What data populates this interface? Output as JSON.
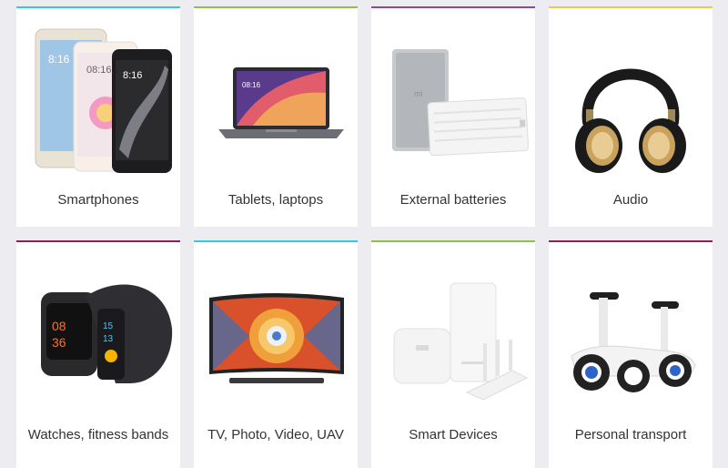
{
  "categories": [
    {
      "label": "Smartphones",
      "accent": "#33c7e8",
      "icon": "smartphones-icon"
    },
    {
      "label": "Tablets, laptops",
      "accent": "#8bc34a",
      "icon": "laptop-icon"
    },
    {
      "label": "External batteries",
      "accent": "#8e44ad",
      "icon": "power-bank-icon"
    },
    {
      "label": "Audio",
      "accent": "#f5c44b",
      "icon": "headphones-icon"
    },
    {
      "label": "Watches, fitness bands",
      "accent": "#8e1f5a",
      "icon": "smartwatch-icon"
    },
    {
      "label": "TV, Photo, Video, UAV",
      "accent": "#33c7e8",
      "icon": "tv-icon"
    },
    {
      "label": "Smart Devices",
      "accent": "#8bc34a",
      "icon": "smart-devices-icon"
    },
    {
      "label": "Personal transport",
      "accent": "#8e1f5a",
      "icon": "scooter-icon"
    }
  ]
}
